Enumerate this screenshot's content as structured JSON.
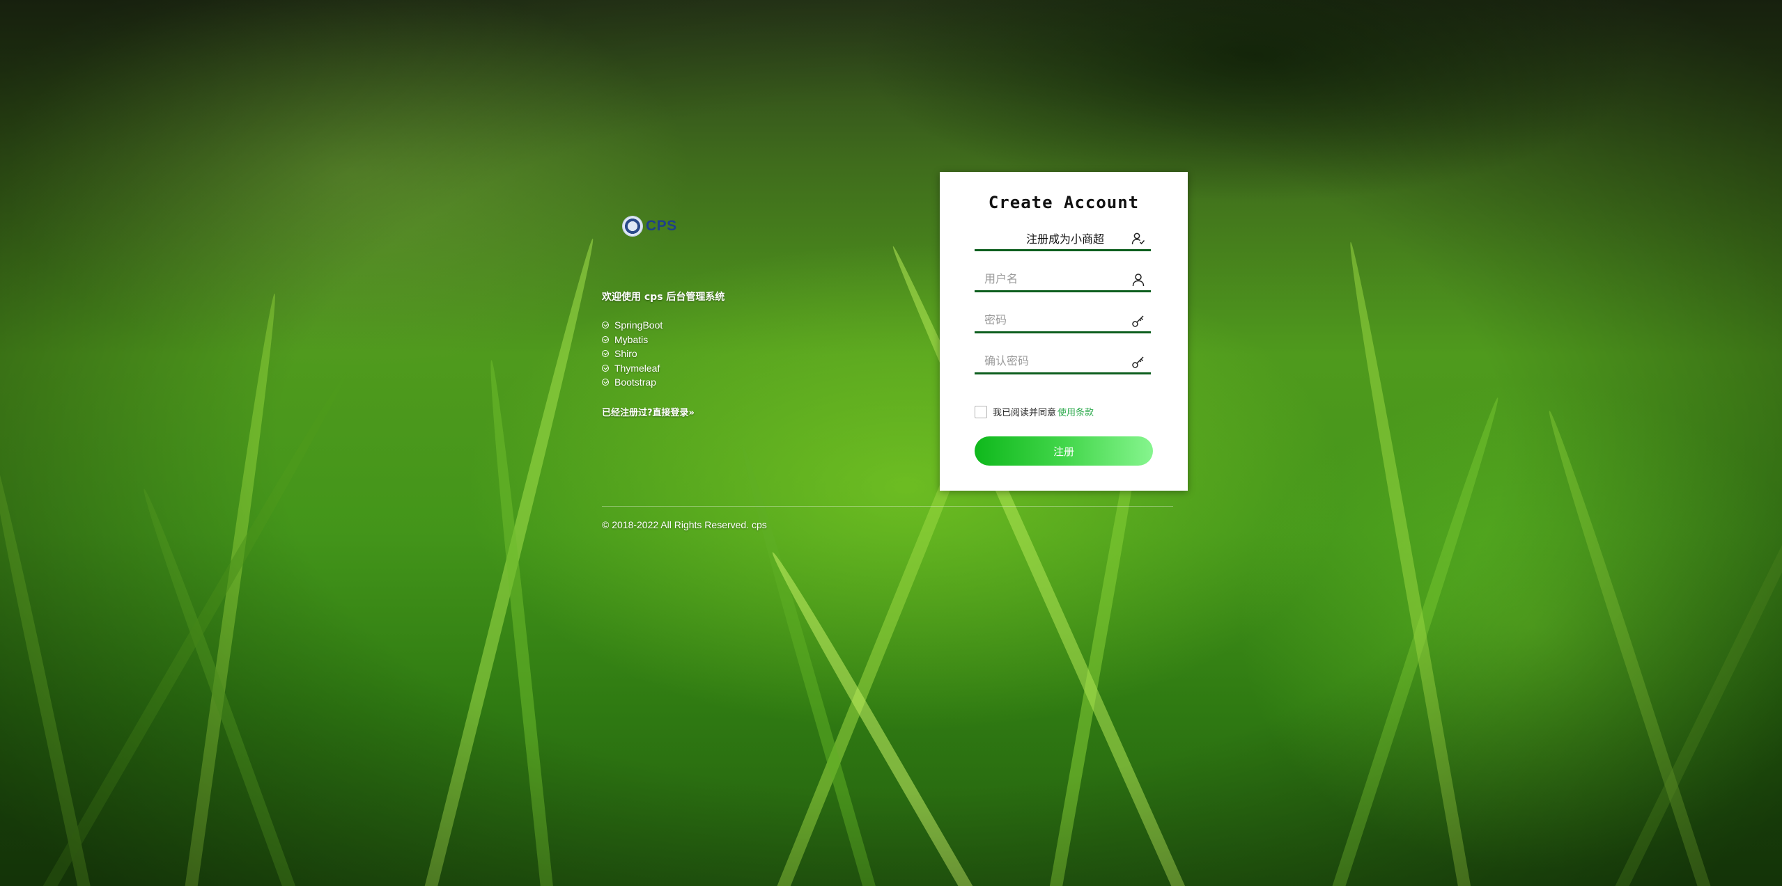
{
  "brand": {
    "name": "CPS",
    "logo_icon": "cps-logo-badge"
  },
  "info": {
    "welcome": "欢迎使用 cps 后台管理系统",
    "features": [
      "SpringBoot",
      "Mybatis",
      "Shiro",
      "Thymeleaf",
      "Bootstrap"
    ],
    "registered_prefix": "已经注册过?",
    "login_link": "直接登录»",
    "copyright": "© 2018-2022 All Rights Reserved. cps"
  },
  "form": {
    "title": "Create Account",
    "account_type": {
      "value": "注册成为小商超",
      "icon": "user-check-icon"
    },
    "username": {
      "placeholder": "用户名",
      "value": "",
      "icon": "user-icon"
    },
    "password": {
      "placeholder": "密码",
      "value": "",
      "icon": "key-icon"
    },
    "confirm_password": {
      "placeholder": "确认密码",
      "value": "",
      "icon": "key-icon"
    },
    "agree_text": "我已阅读并同意",
    "terms_link": "使用条款",
    "agree_checked": false,
    "submit_label": "注册"
  },
  "colors": {
    "field_underline": "#0d5e1e",
    "terms_link": "#2aa84a",
    "button_gradient_start": "#0fb81c",
    "button_gradient_end": "#86f58e"
  }
}
